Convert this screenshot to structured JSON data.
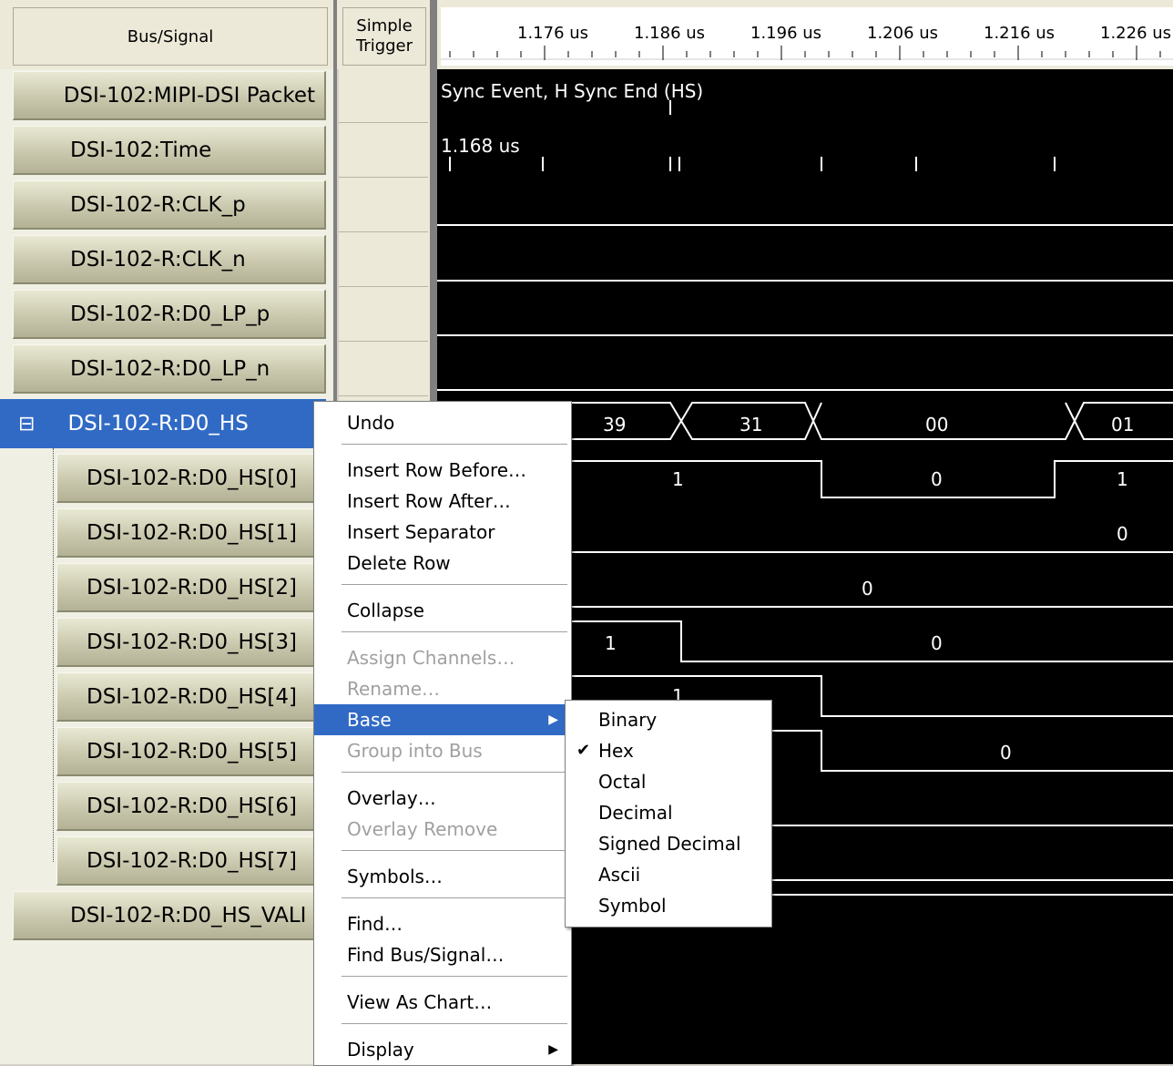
{
  "header": {
    "bus_signal_label": "Bus/Signal",
    "trigger_label_line1": "Simple",
    "trigger_label_line2": "Trigger",
    "time_ticks": [
      "1.176 us",
      "1.186 us",
      "1.196 us",
      "1.206 us",
      "1.216 us",
      "1.226 us"
    ]
  },
  "signals": [
    {
      "label": "DSI-102:MIPI-DSI Packet"
    },
    {
      "label": "DSI-102:Time"
    },
    {
      "label": "DSI-102-R:CLK_p"
    },
    {
      "label": "DSI-102-R:CLK_n"
    },
    {
      "label": "DSI-102-R:D0_LP_p"
    },
    {
      "label": "DSI-102-R:D0_LP_n"
    },
    {
      "label": "DSI-102-R:D0_HS",
      "expander": "⊟"
    },
    {
      "label": "DSI-102-R:D0_HS[0]"
    },
    {
      "label": "DSI-102-R:D0_HS[1]"
    },
    {
      "label": "DSI-102-R:D0_HS[2]"
    },
    {
      "label": "DSI-102-R:D0_HS[3]"
    },
    {
      "label": "DSI-102-R:D0_HS[4]"
    },
    {
      "label": "DSI-102-R:D0_HS[5]"
    },
    {
      "label": "DSI-102-R:D0_HS[6]"
    },
    {
      "label": "DSI-102-R:D0_HS[7]"
    },
    {
      "label": "DSI-102-R:D0_HS_VALI"
    }
  ],
  "waveform": {
    "packet_text": "Sync Event, H Sync End (HS)",
    "time_text": "1.168 us",
    "bus_values": [
      "39",
      "31",
      "00",
      "01"
    ],
    "bit0_values": [
      "1",
      "0",
      "1"
    ],
    "bit1_value": "0",
    "bit2_value": "0",
    "bit3_values": [
      "1",
      "0"
    ],
    "bit4_value": "1",
    "bit5_value": "0"
  },
  "context_menu": {
    "items": [
      "Undo",
      "Insert Row Before…",
      "Insert Row After…",
      "Insert Separator",
      "Delete Row",
      "Collapse",
      "Assign Channels…",
      "Rename…",
      "Base",
      "Group into Bus",
      "Overlay…",
      "Overlay Remove",
      "Symbols…",
      "Find…",
      "Find Bus/Signal…",
      "View As Chart…",
      "Display"
    ]
  },
  "base_submenu": {
    "items": [
      "Binary",
      "Hex",
      "Octal",
      "Decimal",
      "Signed Decimal",
      "Ascii",
      "Symbol"
    ],
    "selected": "Hex"
  },
  "colors": {
    "selection": "#316ac5",
    "waveform_bg": "#000000"
  }
}
